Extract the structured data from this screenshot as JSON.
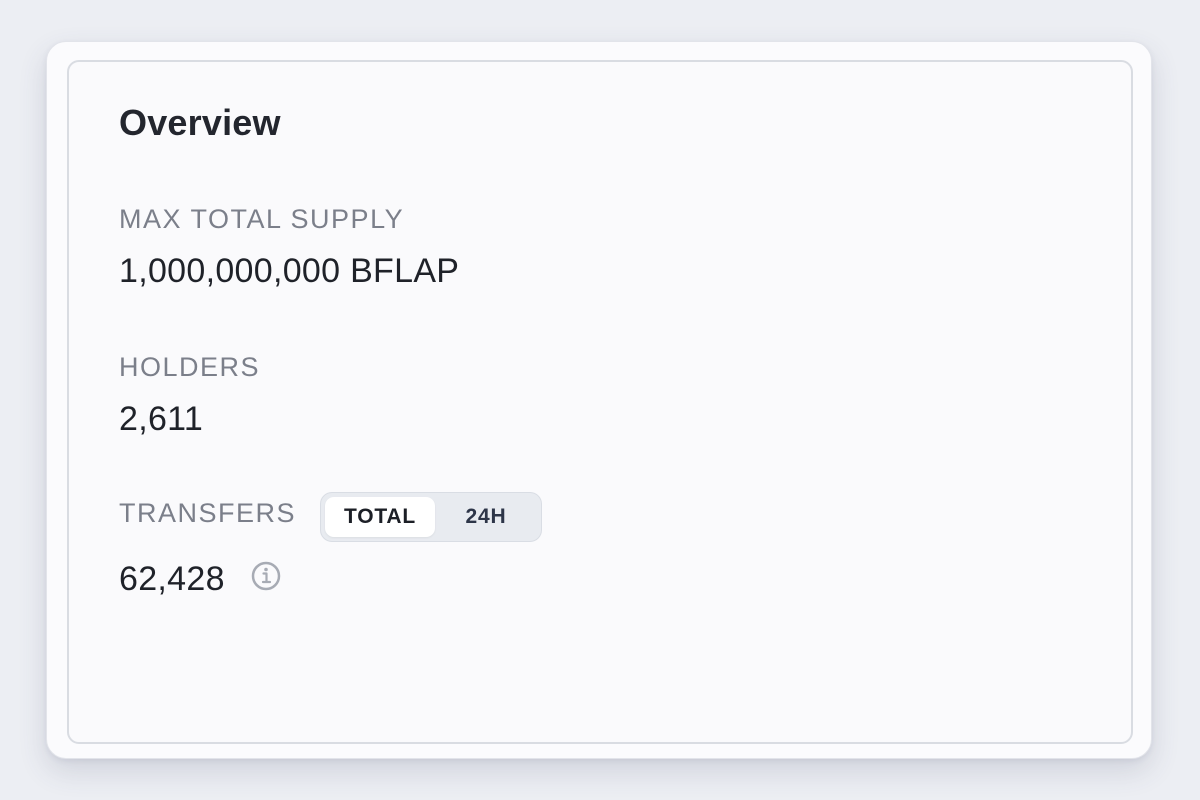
{
  "overview": {
    "title": "Overview",
    "max_total_supply": {
      "label": "MAX TOTAL SUPPLY",
      "value": "1,000,000,000 BFLAP"
    },
    "holders": {
      "label": "HOLDERS",
      "value": "2,611"
    },
    "transfers": {
      "label": "TRANSFERS",
      "value": "62,428",
      "toggle": {
        "options": [
          "TOTAL",
          "24H"
        ],
        "selected": "TOTAL"
      },
      "info_icon": "info-icon"
    }
  },
  "colors": {
    "page_background": "#eceef3",
    "card_background": "#fafafc",
    "label_text": "#7b7f8a",
    "value_text": "#1f2229",
    "toggle_background": "#e8ebf0"
  }
}
